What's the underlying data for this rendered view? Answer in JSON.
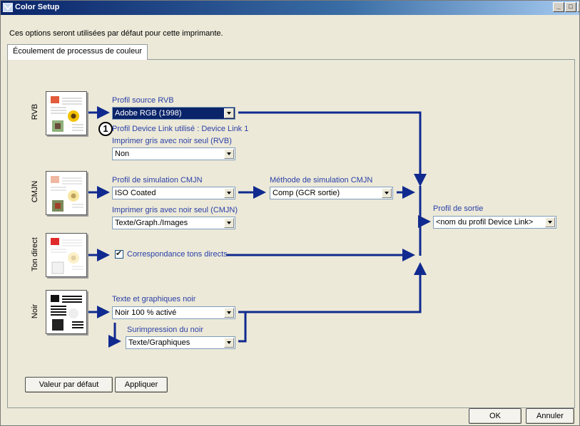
{
  "window": {
    "title": "Color Setup"
  },
  "description": "Ces options seront utilisées par défaut pour cette imprimante.",
  "tab": {
    "label": "Écoulement de processus de couleur"
  },
  "colors": {
    "link_blue": "#2a3fa8",
    "arrow_blue": "#102a8f",
    "selection": "#0a246a"
  },
  "rows": {
    "rgb": {
      "label": "RVB",
      "source_profile_label": "Profil source RVB",
      "source_profile_value": "Adobe RGB (1998)",
      "device_link_info": "Profil Device Link utilisé : Device Link 1",
      "gray_label": "Imprimer gris avec noir seul (RVB)",
      "gray_value": "Non"
    },
    "cmyk": {
      "label": "CMJN",
      "simulation_profile_label": "Profil de simulation CMJN",
      "simulation_profile_value": "ISO Coated",
      "simulation_method_label": "Méthode de simulation CMJN",
      "simulation_method_value": "Comp (GCR sortie)",
      "gray_label": "Imprimer gris avec noir seul (CMJN)",
      "gray_value": "Texte/Graph./Images"
    },
    "spot": {
      "label": "Ton direct",
      "spot_matching_label": "Correspondance tons directs",
      "spot_matching_checked": true
    },
    "black": {
      "label": "Noir",
      "text_graphics_label": "Texte et graphiques noir",
      "text_graphics_value": "Noir 100 % activé",
      "overprint_label": "Surimpression du noir",
      "overprint_value": "Texte/Graphiques"
    }
  },
  "output": {
    "label": "Profil de sortie",
    "value": "<nom du profil Device Link>"
  },
  "callout": "1",
  "buttons": {
    "default": "Valeur par défaut",
    "apply": "Appliquer",
    "ok": "OK",
    "cancel": "Annuler"
  }
}
